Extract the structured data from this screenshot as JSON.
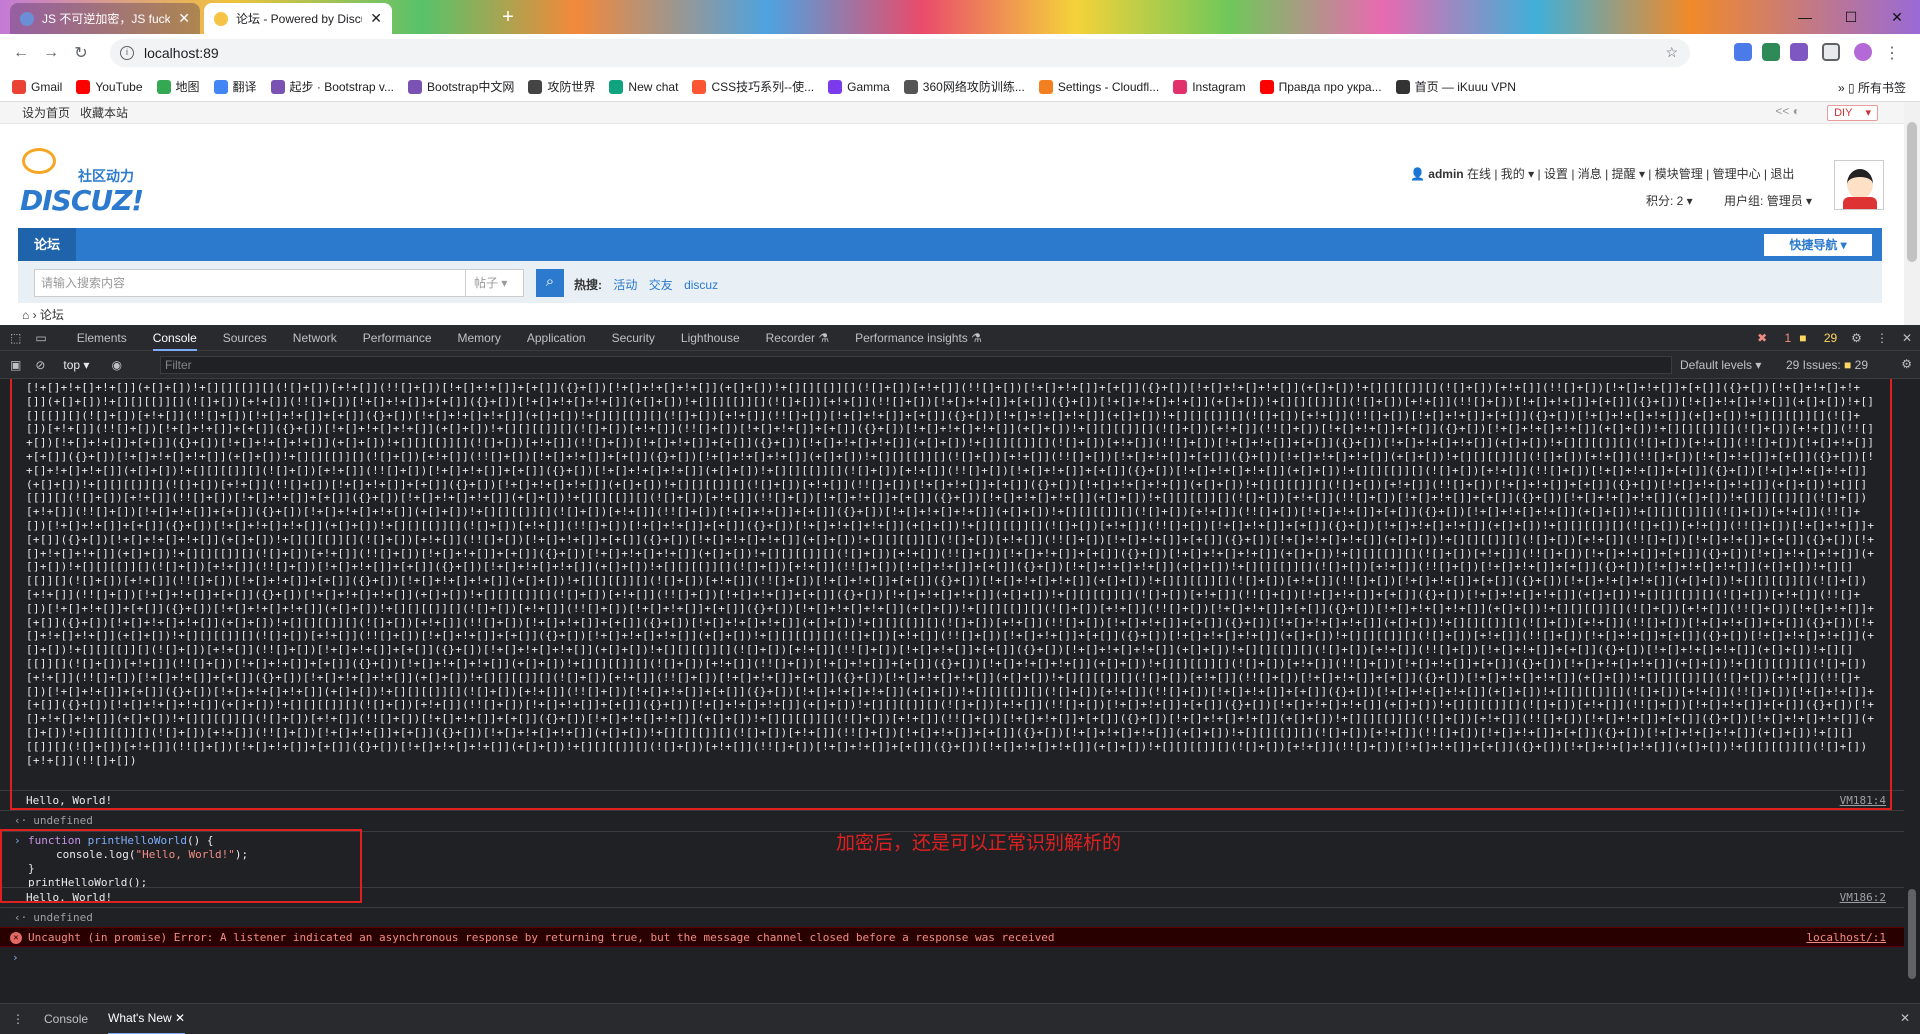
{
  "browser": {
    "tabs": [
      {
        "title": "JS 不可逆加密，JS fuck 加密...",
        "active": false
      },
      {
        "title": "论坛 - Powered by Discuz!",
        "active": true
      }
    ],
    "new_tab": "+",
    "url": "localhost:89",
    "bookmarks": [
      {
        "label": "Gmail",
        "color": "#ea4335"
      },
      {
        "label": "YouTube",
        "color": "#ff0000"
      },
      {
        "label": "地图",
        "color": "#34a853"
      },
      {
        "label": "翻译",
        "color": "#4285f4"
      },
      {
        "label": "起步 · Bootstrap v...",
        "color": "#7952b3"
      },
      {
        "label": "Bootstrap中文网",
        "color": "#7952b3"
      },
      {
        "label": "攻防世界",
        "color": "#444444"
      },
      {
        "label": "New chat",
        "color": "#10a37f"
      },
      {
        "label": "CSS技巧系列--使...",
        "color": "#fc5531"
      },
      {
        "label": "Gamma",
        "color": "#7c3aed"
      },
      {
        "label": "360网络攻防训练...",
        "color": "#555555"
      },
      {
        "label": "Settings - Cloudfl...",
        "color": "#f38020"
      },
      {
        "label": "Instagram",
        "color": "#e1306c"
      },
      {
        "label": "Правда про укра...",
        "color": "#ff0000"
      },
      {
        "label": "首页 — iKuuu VPN",
        "color": "#333333"
      }
    ],
    "bookmarks_more": "»",
    "all_bookmarks": "所有书签"
  },
  "site": {
    "topbar": {
      "set_home": "设为首页",
      "bookmark": "收藏本站",
      "diy": "DIY"
    },
    "logo": {
      "top": "社区动力",
      "main": "DISCUZ!"
    },
    "user": {
      "name": "admin",
      "status": "在线",
      "links": [
        "我的",
        "设置",
        "消息",
        "提醒",
        "模块管理",
        "管理中心",
        "退出"
      ],
      "points": "积分: 2",
      "group": "用户组: 管理员"
    },
    "nav": {
      "current": "论坛",
      "quick": "快捷导航"
    },
    "search": {
      "placeholder": "请输入搜索内容",
      "type": "帖子",
      "hot_label": "热搜:",
      "hot": [
        "活动",
        "交友",
        "discuz"
      ]
    },
    "breadcrumb": "论坛"
  },
  "devtools": {
    "tabs": [
      "Elements",
      "Console",
      "Sources",
      "Network",
      "Performance",
      "Memory",
      "Application",
      "Security",
      "Lighthouse",
      "Recorder",
      "Performance insights"
    ],
    "active_tab": "Console",
    "errors": "1",
    "warnings": "29",
    "context": "top",
    "filter_placeholder": "Filter",
    "levels": "Default levels",
    "issues": "29 Issues:",
    "issues_count": "29",
    "console": {
      "output1": "Hello, World!",
      "src1": "VM181:4",
      "undefined": "undefined",
      "code": [
        "function printHelloWorld() {",
        "    console.log(\"Hello, World!\");",
        "}",
        "printHelloWorld();"
      ],
      "output2": "Hello, World!",
      "src2": "VM186:2",
      "error": "Uncaught (in promise) Error: A listener indicated an asynchronous response by returning true, but the message channel closed before a response was received",
      "error_src": "localhost/:1",
      "annotation": "加密后，还是可以正常识别解析的"
    },
    "drawer": {
      "tabs": [
        "Console",
        "What's New"
      ]
    }
  }
}
